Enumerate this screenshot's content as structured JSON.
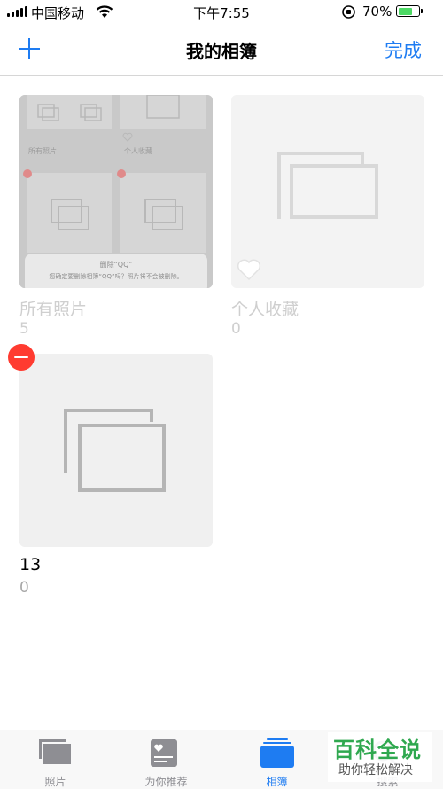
{
  "status_bar": {
    "carrier": "中国移动",
    "time": "下午7:55",
    "battery_percent": "70%",
    "battery_level": 0.7
  },
  "nav": {
    "title": "我的相簿",
    "done_label": "完成"
  },
  "albums": [
    {
      "title": "所有照片",
      "count": "5",
      "preview": {
        "labels": [
          "所有照片",
          "个人收藏"
        ],
        "dialog_title": "删除“QQ”",
        "dialog_message": "您确定要删除相簿“QQ”吗？照片将不会被删除。"
      }
    },
    {
      "title": "个人收藏",
      "count": "0"
    },
    {
      "title": "13",
      "count": "0"
    }
  ],
  "tabs": [
    {
      "label": "照片",
      "icon": "photos-icon"
    },
    {
      "label": "为你推荐",
      "icon": "for-you-icon"
    },
    {
      "label": "相簿",
      "icon": "albums-icon",
      "active": true
    },
    {
      "label": "搜索",
      "icon": "search-icon"
    }
  ],
  "watermark": {
    "title": "百科全说",
    "subtitle": "助你轻松解决"
  },
  "colors": {
    "accent": "#1e7cf2",
    "delete": "#ff3b30",
    "battery": "#4cd964"
  }
}
